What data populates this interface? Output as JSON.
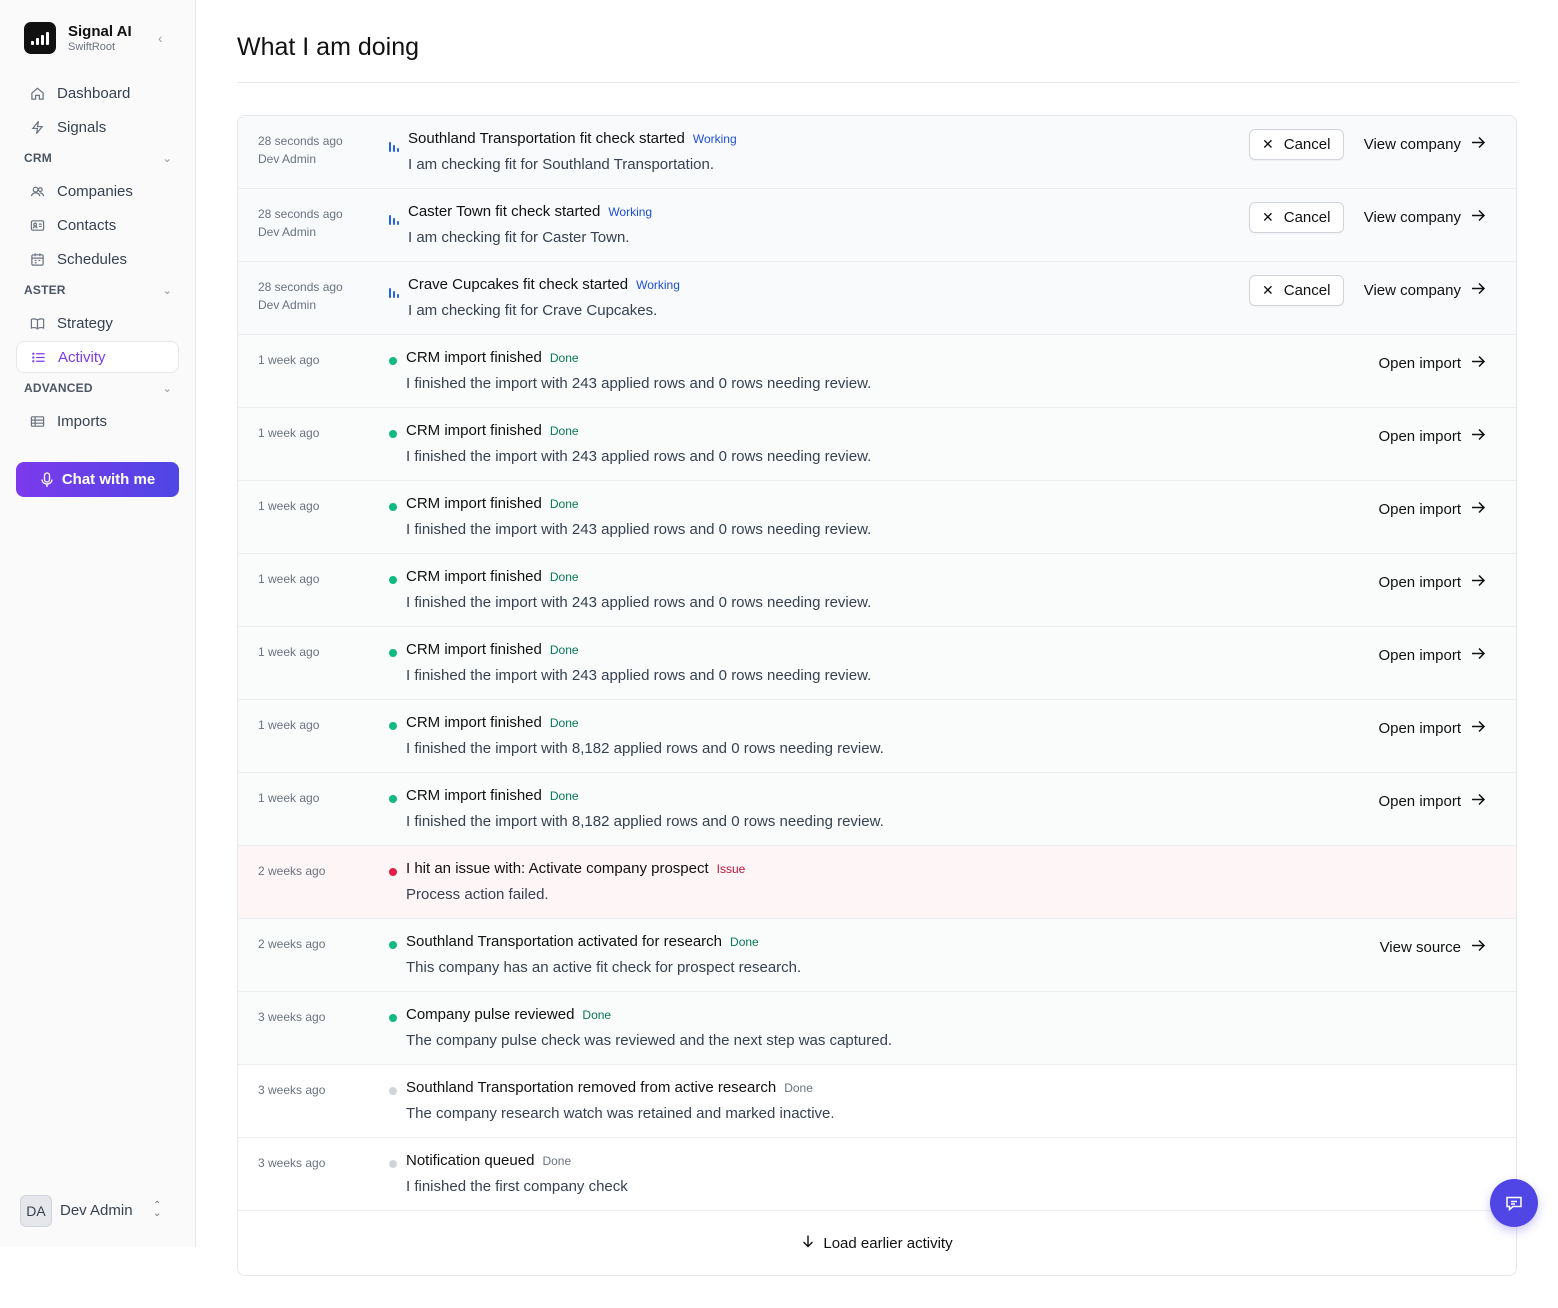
{
  "brand": {
    "name": "Signal AI",
    "workspace": "SwiftRoot"
  },
  "nav": {
    "dashboard": "Dashboard",
    "signals": "Signals",
    "crm_section": "CRM",
    "companies": "Companies",
    "contacts": "Contacts",
    "schedules": "Schedules",
    "aster_section": "ASTER",
    "strategy": "Strategy",
    "activity": "Activity",
    "advanced_section": "ADVANCED",
    "imports": "Imports"
  },
  "chat_button": "Chat with me",
  "user": {
    "initials": "DA",
    "name": "Dev Admin"
  },
  "page": {
    "title": "What I am doing"
  },
  "colors": {
    "accent": "#7c3aed",
    "working": "#2563eb",
    "done": "#10b981",
    "issue": "#e11d48"
  },
  "activities": [
    {
      "time": "28 seconds ago",
      "actor": "Dev Admin",
      "title": "Southland Transportation fit check started",
      "status": "Working",
      "description": "I am checking fit for Southland Transportation.",
      "cancel": "Cancel",
      "action": "View company"
    },
    {
      "time": "28 seconds ago",
      "actor": "Dev Admin",
      "title": "Caster Town fit check started",
      "status": "Working",
      "description": "I am checking fit for Caster Town.",
      "cancel": "Cancel",
      "action": "View company"
    },
    {
      "time": "28 seconds ago",
      "actor": "Dev Admin",
      "title": "Crave Cupcakes fit check started",
      "status": "Working",
      "description": "I am checking fit for Crave Cupcakes.",
      "cancel": "Cancel",
      "action": "View company"
    },
    {
      "time": "1 week ago",
      "title": "CRM import finished",
      "status": "Done",
      "description": "I finished the import with 243 applied rows and 0 rows needing review.",
      "action": "Open import"
    },
    {
      "time": "1 week ago",
      "title": "CRM import finished",
      "status": "Done",
      "description": "I finished the import with 243 applied rows and 0 rows needing review.",
      "action": "Open import"
    },
    {
      "time": "1 week ago",
      "title": "CRM import finished",
      "status": "Done",
      "description": "I finished the import with 243 applied rows and 0 rows needing review.",
      "action": "Open import"
    },
    {
      "time": "1 week ago",
      "title": "CRM import finished",
      "status": "Done",
      "description": "I finished the import with 243 applied rows and 0 rows needing review.",
      "action": "Open import"
    },
    {
      "time": "1 week ago",
      "title": "CRM import finished",
      "status": "Done",
      "description": "I finished the import with 243 applied rows and 0 rows needing review.",
      "action": "Open import"
    },
    {
      "time": "1 week ago",
      "title": "CRM import finished",
      "status": "Done",
      "description": "I finished the import with 8,182 applied rows and 0 rows needing review.",
      "action": "Open import"
    },
    {
      "time": "1 week ago",
      "title": "CRM import finished",
      "status": "Done",
      "description": "I finished the import with 8,182 applied rows and 0 rows needing review.",
      "action": "Open import"
    },
    {
      "time": "2 weeks ago",
      "title": "I hit an issue with: Activate company prospect",
      "status": "Issue",
      "description": "Process action failed."
    },
    {
      "time": "2 weeks ago",
      "title": "Southland Transportation activated for research",
      "status": "Done",
      "description": "This company has an active fit check for prospect research.",
      "action": "View source"
    },
    {
      "time": "3 weeks ago",
      "title": "Company pulse reviewed",
      "status": "Done",
      "description": "The company pulse check was reviewed and the next step was captured."
    },
    {
      "time": "3 weeks ago",
      "title": "Southland Transportation removed from active research",
      "status": "Done",
      "description": "The company research watch was retained and marked inactive."
    },
    {
      "time": "3 weeks ago",
      "title": "Notification queued",
      "status": "Done",
      "description": "I finished the first company check"
    }
  ],
  "load_more": "Load earlier activity"
}
